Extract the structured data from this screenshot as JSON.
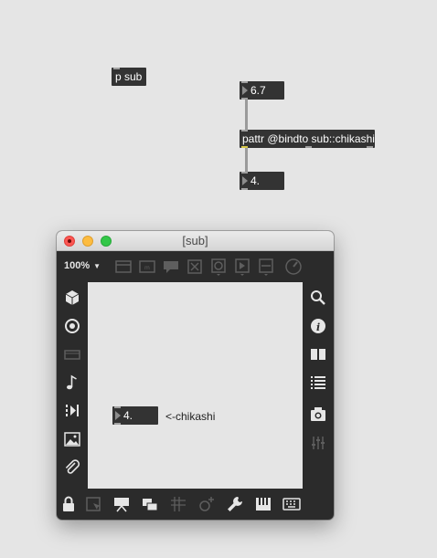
{
  "patcher": {
    "p_sub_label": "p sub",
    "number_top_value": "6.7",
    "pattr_label": "pattr @bindto sub::chikashi",
    "number_bottom_value": "4."
  },
  "window": {
    "title": "[sub]",
    "zoom": "100%",
    "number_value": "4.",
    "comment_text": "<-chikashi"
  },
  "icons": {
    "toolbar": [
      "presentation-icon",
      "message-icon",
      "comment-icon",
      "toggle-icon",
      "button-icon",
      "play-icon",
      "slider-icon",
      "dial-icon"
    ],
    "left_sidebar": [
      "objects-cube-icon",
      "target-icon",
      "display-icon",
      "music-note-icon",
      "sequence-icon",
      "image-icon",
      "paperclip-icon"
    ],
    "right_sidebar": [
      "search-icon",
      "info-icon",
      "reference-book-icon",
      "list-icon",
      "snapshot-camera-icon",
      "mixer-icon"
    ],
    "bottom_bar": [
      "lock-icon",
      "edit-select-icon",
      "presentation-mode-icon",
      "new-view-icon",
      "grid-icon",
      "add-object-icon",
      "wrench-icon",
      "piano-icon",
      "keyboard-icon"
    ]
  },
  "colors": {
    "patch_bg": "#e5e5e5",
    "object_bg": "#333333",
    "window_bg": "#2b2b2b"
  }
}
